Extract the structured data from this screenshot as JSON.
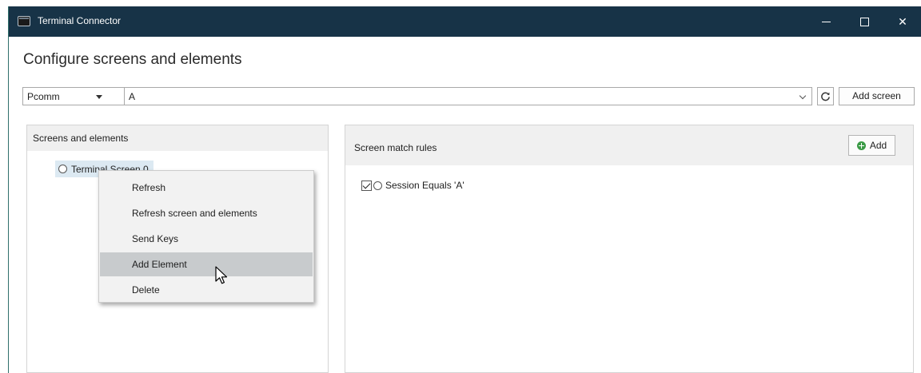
{
  "window": {
    "title": "Terminal Connector",
    "controls": [
      "minimize",
      "maximize",
      "close"
    ],
    "close_glyph": "✕"
  },
  "page": {
    "heading": "Configure screens and elements"
  },
  "toolbar": {
    "connection_select_value": "Pcomm",
    "screen_select_value": "A",
    "refresh_icon": "refresh-icon",
    "add_screen_label": "Add screen"
  },
  "left_panel": {
    "title": "Screens and elements",
    "tree": [
      {
        "label": "Terminal Screen 0",
        "selected": true
      }
    ]
  },
  "context_menu": {
    "items": [
      {
        "label": "Refresh"
      },
      {
        "label": "Refresh screen and elements"
      },
      {
        "label": "Send Keys"
      },
      {
        "label": "Add Element",
        "hovered": true
      },
      {
        "label": "Delete"
      }
    ]
  },
  "right_panel": {
    "title": "Screen match rules",
    "add_label": "Add",
    "rules": [
      {
        "checked": true,
        "label": "Session Equals 'A'"
      }
    ]
  },
  "colors": {
    "titlebar": "#173347",
    "panel_header": "#f0f0f0",
    "tree_selection": "#dce9f2",
    "menu_hover": "#c8cbcd",
    "add_icon": "#3a9a45"
  }
}
